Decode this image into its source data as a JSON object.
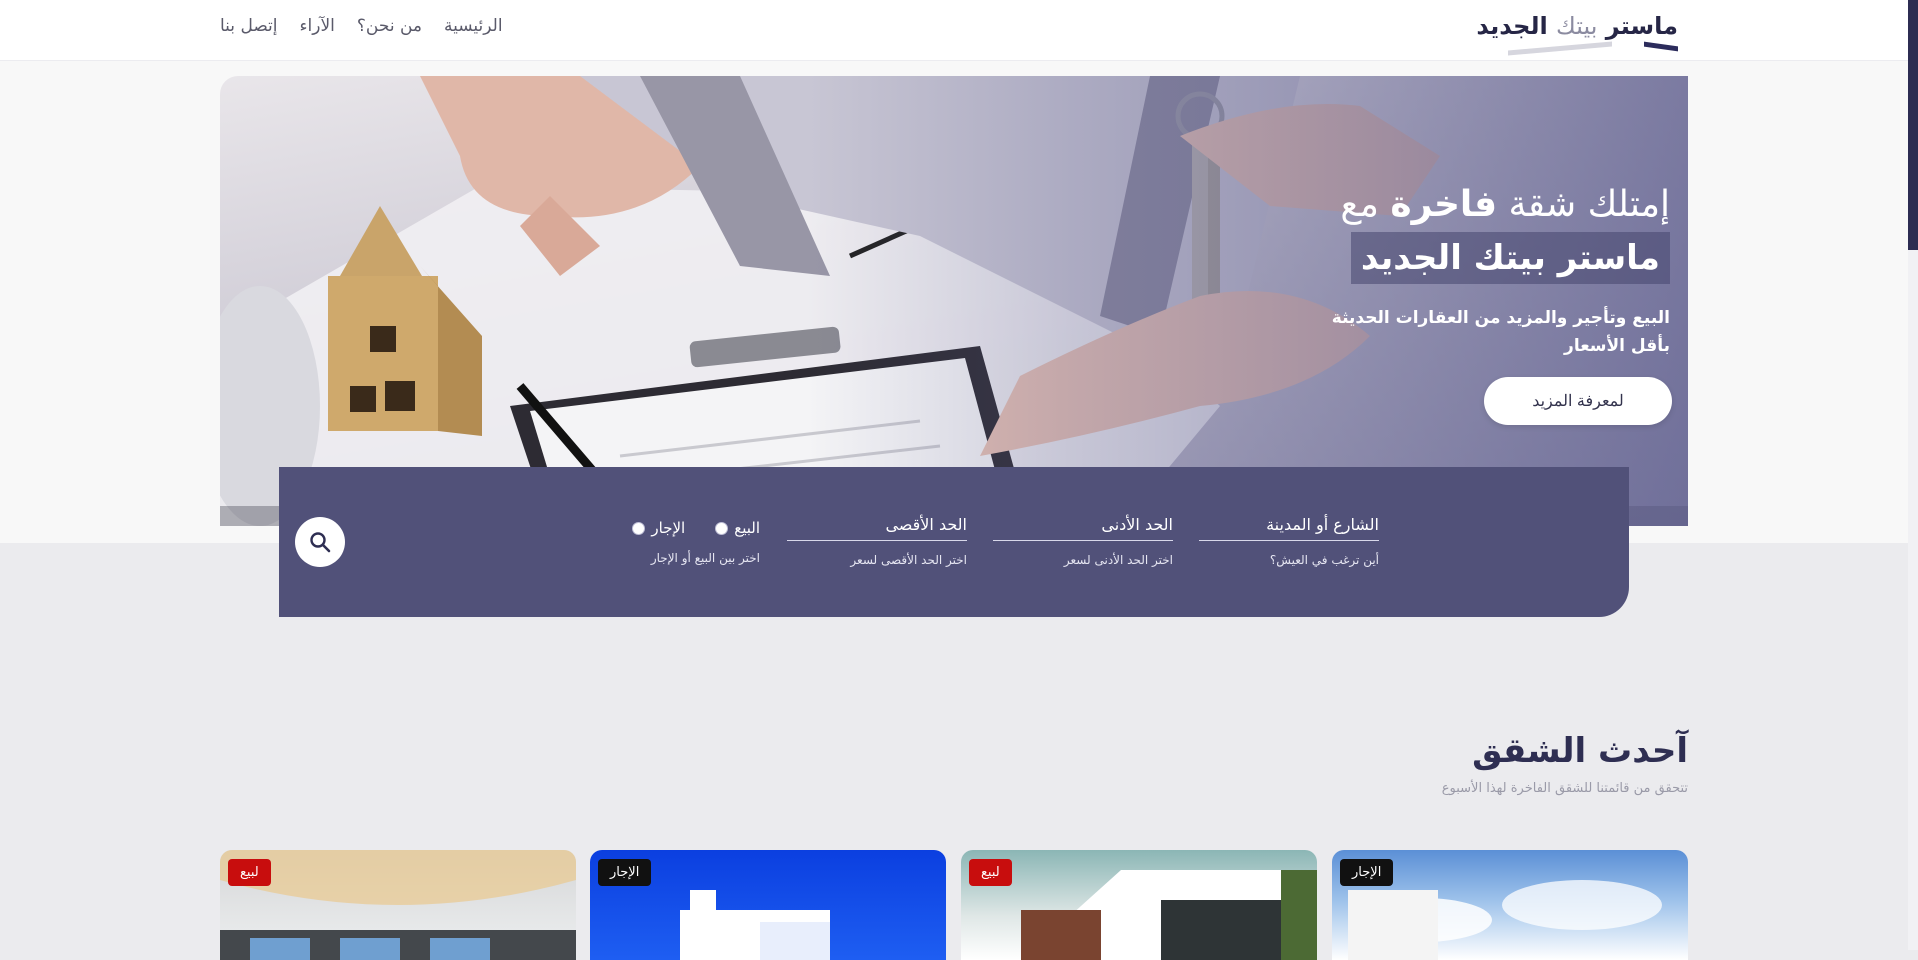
{
  "header": {
    "logo_bold": "ماستر",
    "logo_light": "بيتك",
    "logo_end": "الجديد",
    "nav": [
      {
        "label": "الرئيسية"
      },
      {
        "label": "من نحن؟"
      },
      {
        "label": "الآراء"
      },
      {
        "label": "إتصل بنا"
      }
    ]
  },
  "hero": {
    "title_start": "إمتلك شقة",
    "title_bold": "فاخرة",
    "title_end": "مع",
    "highlight": "ماستر بيتك الجديد",
    "subtitle": "البيع وتأجير والمزيد من العقارات الحديثة بأقل الأسعار",
    "cta_label": "لمعرفة المزيد"
  },
  "search": {
    "fields": [
      {
        "label": "الشارع أو المدينة",
        "hint": "أين ترغب في العيش؟"
      },
      {
        "label": "الحد الأدنى",
        "hint": "اختر الحد الأدنى لسعر"
      },
      {
        "label": "الحد الأقصى",
        "hint": "اختر الحد الأقصى لسعر"
      }
    ],
    "radio_options": [
      {
        "label": "البيع"
      },
      {
        "label": "الإجار"
      }
    ],
    "radio_hint": "اختر بين البيع أو الإجار",
    "button_icon": "search-icon"
  },
  "latest": {
    "title": "آحدث الشقق",
    "subtitle": "تتحقق من قائمتنا للشقق الفاخرة لهذا الأسبوع",
    "cards": [
      {
        "badge": "الإجار"
      },
      {
        "badge": "لبيع"
      },
      {
        "badge": "الإجار"
      },
      {
        "badge": "لبيع"
      }
    ]
  },
  "colors": {
    "brand_dark": "#2e2e52",
    "panel": "#515179",
    "sale_badge": "#c80d0d",
    "rent_badge": "#111111"
  }
}
